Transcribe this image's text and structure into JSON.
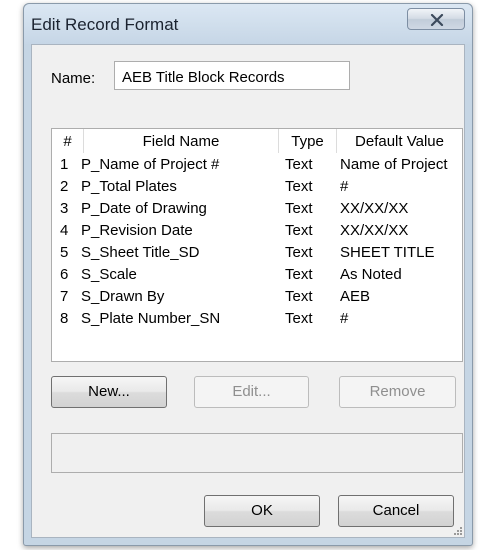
{
  "window": {
    "title": "Edit Record Format"
  },
  "name_field": {
    "label": "Name:",
    "value": "AEB Title Block Records"
  },
  "table": {
    "columns": [
      "#",
      "Field Name",
      "Type",
      "Default Value"
    ],
    "rows": [
      {
        "num": "1",
        "field_name": "P_Name of Project #",
        "type": "Text",
        "default_value": "Name of Project"
      },
      {
        "num": "2",
        "field_name": "P_Total Plates",
        "type": "Text",
        "default_value": "#"
      },
      {
        "num": "3",
        "field_name": "P_Date of Drawing",
        "type": "Text",
        "default_value": "XX/XX/XX"
      },
      {
        "num": "4",
        "field_name": "P_Revision Date",
        "type": "Text",
        "default_value": "XX/XX/XX"
      },
      {
        "num": "5",
        "field_name": "S_Sheet Title_SD",
        "type": "Text",
        "default_value": "SHEET TITLE"
      },
      {
        "num": "6",
        "field_name": "S_Scale",
        "type": "Text",
        "default_value": "As Noted"
      },
      {
        "num": "7",
        "field_name": "S_Drawn By",
        "type": "Text",
        "default_value": "AEB"
      },
      {
        "num": "8",
        "field_name": "S_Plate Number_SN",
        "type": "Text",
        "default_value": "#"
      }
    ]
  },
  "buttons": {
    "new": "New...",
    "edit": "Edit...",
    "remove": "Remove",
    "ok": "OK",
    "cancel": "Cancel"
  },
  "icons": {
    "close": "close-icon",
    "resize": "resize-grip-icon"
  },
  "colors": {
    "frame": "#c5d5e4",
    "client": "#f0f0f0",
    "disabled_text": "#8f8f8f"
  }
}
